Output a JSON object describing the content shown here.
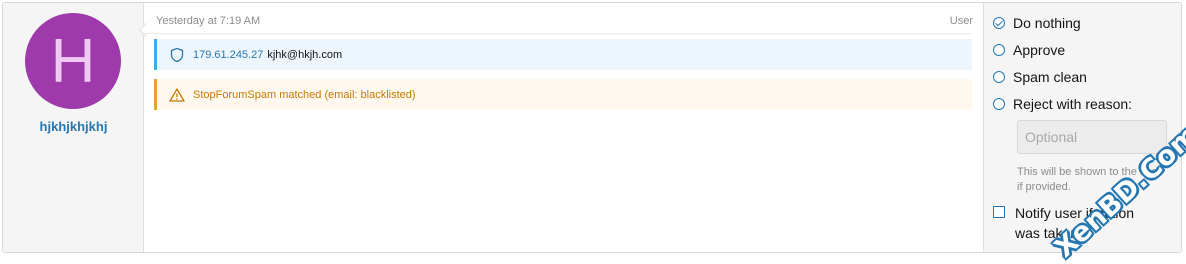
{
  "user": {
    "avatar_letter": "H",
    "avatar_color": "#9e3aab",
    "username": "hjkhjkhjkhj"
  },
  "message": {
    "timestamp": "Yesterday at 7:19 AM",
    "role": "User",
    "ip": "179.61.245.27",
    "email": "kjhk@hkjh.com",
    "warning": "StopForumSpam matched (email: blacklisted)"
  },
  "actions": {
    "options": [
      {
        "label": "Do nothing",
        "checked": true
      },
      {
        "label": "Approve",
        "checked": false
      },
      {
        "label": "Spam clean",
        "checked": false
      },
      {
        "label": "Reject with reason:",
        "checked": false
      }
    ],
    "reason_placeholder": "Optional",
    "hint": "This will be shown to the user if provided.",
    "notify_label": "Notify user if action was taken"
  },
  "watermark": "XenBD.Com",
  "colors": {
    "accent": "#2577b1",
    "info_bar": "#47a7eb",
    "warning_bar": "#e3a23a",
    "warning_text": "#c77a00"
  }
}
